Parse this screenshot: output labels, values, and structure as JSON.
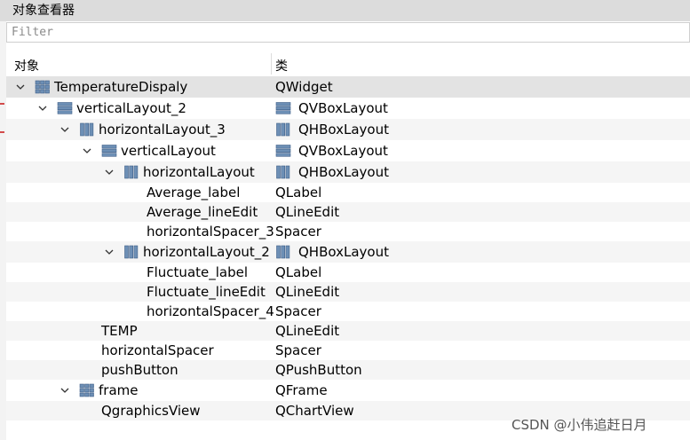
{
  "panel": {
    "title": "对象查看器"
  },
  "filter": {
    "placeholder": "Filter"
  },
  "columns": {
    "object": "对象",
    "class": "类"
  },
  "rows": [
    {
      "name": "TemperatureDispaly",
      "cls": "QWidget",
      "depth": 0,
      "expanded": true,
      "icon": "grid-icon",
      "cicon": ""
    },
    {
      "name": "verticalLayout_2",
      "cls": "QVBoxLayout",
      "depth": 1,
      "expanded": true,
      "icon": "vbox-layout-icon",
      "cicon": "vbox-layout-icon"
    },
    {
      "name": "horizontalLayout_3",
      "cls": "QHBoxLayout",
      "depth": 2,
      "expanded": true,
      "icon": "hbox-layout-icon",
      "cicon": "hbox-layout-icon"
    },
    {
      "name": "verticalLayout",
      "cls": "QVBoxLayout",
      "depth": 3,
      "expanded": true,
      "icon": "vbox-layout-icon",
      "cicon": "vbox-layout-icon"
    },
    {
      "name": "horizontalLayout",
      "cls": "QHBoxLayout",
      "depth": 4,
      "expanded": true,
      "icon": "hbox-layout-icon",
      "cicon": "hbox-layout-icon"
    },
    {
      "name": "Average_label",
      "cls": "QLabel",
      "depth": 5,
      "expanded": null,
      "icon": "",
      "cicon": ""
    },
    {
      "name": "Average_lineEdit",
      "cls": "QLineEdit",
      "depth": 5,
      "expanded": null,
      "icon": "",
      "cicon": ""
    },
    {
      "name": "horizontalSpacer_3",
      "cls": "Spacer",
      "depth": 5,
      "expanded": null,
      "icon": "",
      "cicon": ""
    },
    {
      "name": "horizontalLayout_2",
      "cls": "QHBoxLayout",
      "depth": 4,
      "expanded": true,
      "icon": "hbox-layout-icon",
      "cicon": "hbox-layout-icon"
    },
    {
      "name": "Fluctuate_label",
      "cls": "QLabel",
      "depth": 5,
      "expanded": null,
      "icon": "",
      "cicon": ""
    },
    {
      "name": "Fluctuate_lineEdit",
      "cls": "QLineEdit",
      "depth": 5,
      "expanded": null,
      "icon": "",
      "cicon": ""
    },
    {
      "name": "horizontalSpacer_4",
      "cls": "Spacer",
      "depth": 5,
      "expanded": null,
      "icon": "",
      "cicon": ""
    },
    {
      "name": "TEMP",
      "cls": "QLineEdit",
      "depth": 3,
      "expanded": null,
      "icon": "",
      "cicon": ""
    },
    {
      "name": "horizontalSpacer",
      "cls": "Spacer",
      "depth": 3,
      "expanded": null,
      "icon": "",
      "cicon": ""
    },
    {
      "name": "pushButton",
      "cls": "QPushButton",
      "depth": 3,
      "expanded": null,
      "icon": "",
      "cicon": ""
    },
    {
      "name": "frame",
      "cls": "QFrame",
      "depth": 2,
      "expanded": true,
      "icon": "grid-icon",
      "cicon": ""
    },
    {
      "name": "QgraphicsView",
      "cls": "QChartView",
      "depth": 3,
      "expanded": null,
      "icon": "",
      "cicon": ""
    }
  ],
  "watermark": "CSDN @小伟追赶日月"
}
